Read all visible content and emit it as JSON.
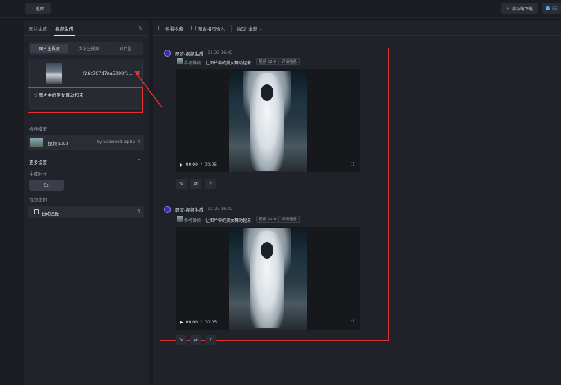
{
  "topbar": {
    "back_label": "返回",
    "mobile_download_label": "移动端下载",
    "credits_value": "65"
  },
  "left": {
    "tabs": [
      {
        "label": "图片生成",
        "active": false
      },
      {
        "label": "视频生成",
        "active": true
      }
    ],
    "modes": [
      {
        "label": "图片生视频",
        "active": true
      },
      {
        "label": "文本生视频",
        "active": false
      },
      {
        "label": "对口型",
        "active": false
      }
    ],
    "image_card": {
      "filename": "f26c707d7aa5890f1..."
    },
    "prompt_text": "让图片中的美女舞动起来",
    "model_section_label": "视频模型",
    "model": {
      "name": "视频 S2.0",
      "by": "by Seaweed alpha"
    },
    "more_settings_label": "更多设置",
    "duration_label": "生成时长",
    "duration_value": "5s",
    "ratio_label": "视频比例",
    "ratio_value": "自动匹配"
  },
  "filters": {
    "favorites_label": "仅看收藏",
    "merge_label": "聚合相同输入",
    "type_label": "类型: 全部"
  },
  "entries": [
    {
      "title": "即梦-视频生成",
      "time": "11-23  16:42",
      "ref_label": "参考首帧",
      "ref_prompt": "让图片中的美女舞动起来",
      "tags": [
        "视频 S2.0",
        "详细信息"
      ],
      "current_time": "00:00",
      "duration": "00:05"
    },
    {
      "title": "即梦-视频生成",
      "time": "11-23  16:42",
      "ref_label": "参考首帧",
      "ref_prompt": "让图片中的美女舞动起来",
      "tags": [
        "视频 S2.0",
        "详细信息"
      ],
      "current_time": "00:00",
      "duration": "00:05"
    }
  ],
  "colors": {
    "accent_red": "#e0322f",
    "accent_purple": "#6b5cff",
    "accent_blue": "#4fb3ff"
  }
}
